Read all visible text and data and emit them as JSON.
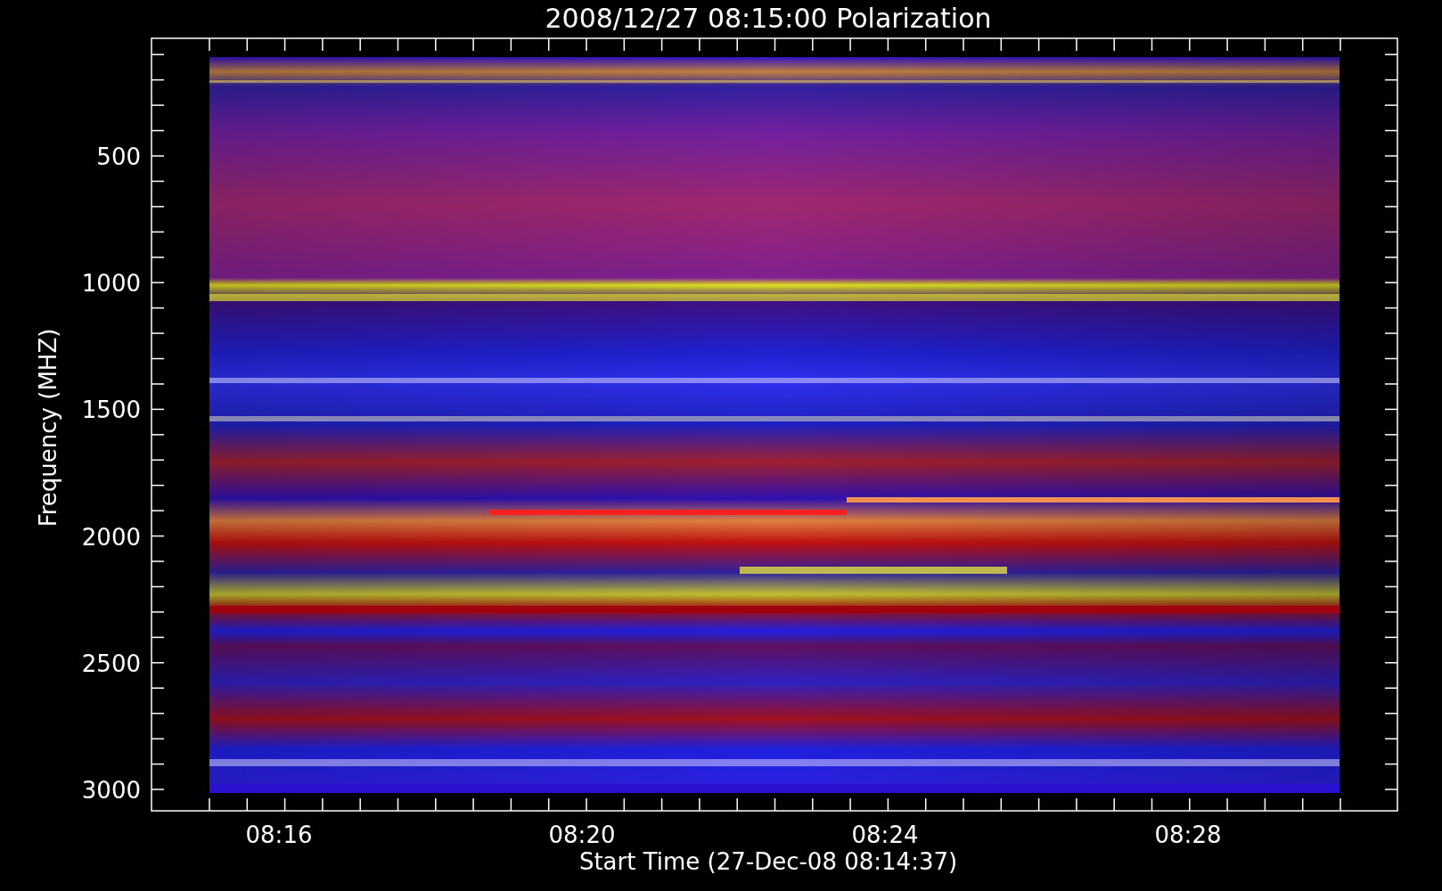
{
  "title": "2008/12/27 08:15:00 Polarization",
  "y_axis": {
    "label": "Frequency (MHZ)",
    "ticks": [
      "500",
      "1000",
      "1500",
      "2000",
      "2500",
      "3000"
    ]
  },
  "x_axis": {
    "label": "Start Time (27-Dec-08 08:14:37)",
    "ticks": [
      "08:16",
      "08:20",
      "08:24",
      "08:28"
    ]
  }
}
